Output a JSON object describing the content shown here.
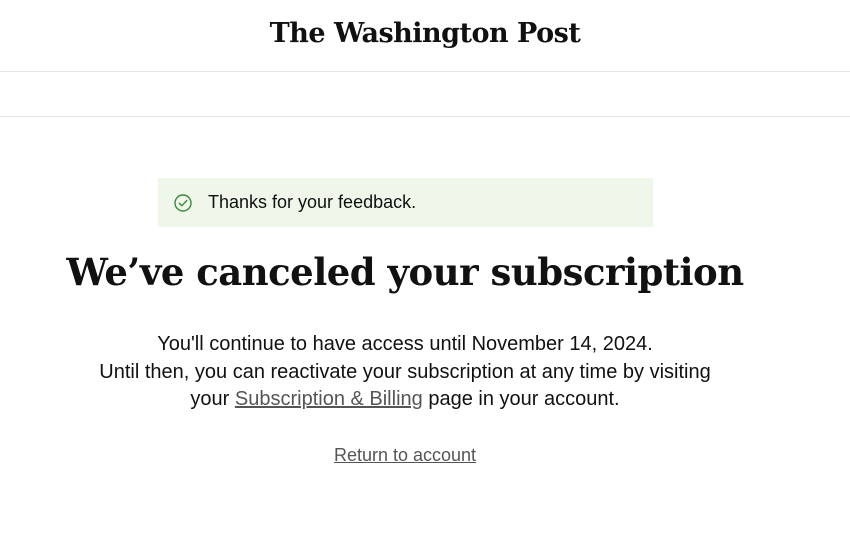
{
  "header": {
    "logo_text": "The Washington Post"
  },
  "banner": {
    "icon": "check-circle-icon",
    "message": "Thanks for your feedback.",
    "background": "#eef7ea",
    "icon_color": "#3b8a3b"
  },
  "main": {
    "headline": "We’ve canceled your subscription",
    "line1": "You'll continue to have access until November 14, 2024.",
    "line2": "Until then, you can reactivate your subscription at any time by visiting",
    "line3_prefix": "your",
    "billing_link": "Subscription & Billing",
    "line3_suffix": "page in your account.",
    "return_link": "Return to account"
  }
}
